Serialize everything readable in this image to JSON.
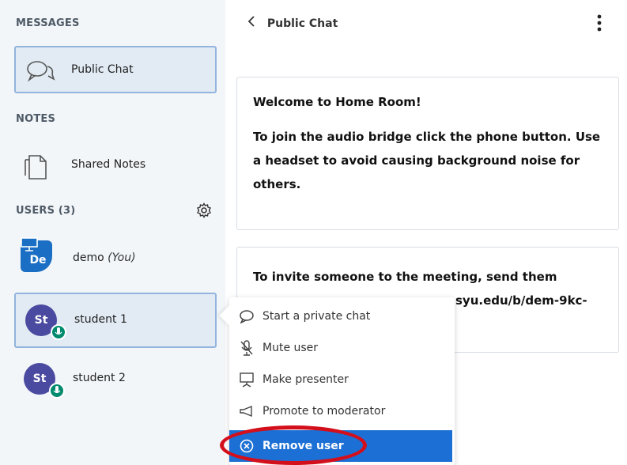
{
  "sidebar": {
    "messages_title": "MESSAGES",
    "public_chat_label": "Public Chat",
    "notes_title": "NOTES",
    "shared_notes_label": "Shared Notes",
    "users_title": "USERS (3)",
    "users": [
      {
        "initials": "De",
        "name": "demo",
        "suffix": "(You)",
        "role": "presenter"
      },
      {
        "initials": "St",
        "name": "student 1",
        "selected": true
      },
      {
        "initials": "St",
        "name": "student 2"
      }
    ]
  },
  "chat": {
    "header_title": "Public Chat",
    "welcome_messages": [
      "Welcome to Home Room!",
      "To join the audio bridge click the phone button. Use a headset to avoid causing background noise for others."
    ],
    "invite_message_partial": [
      "To invite someone to the meeting, send them",
      "syu.edu/b/dem-9kc-"
    ]
  },
  "context_menu": {
    "items": [
      {
        "label": "Start a private chat",
        "icon": "chat-bubble-icon"
      },
      {
        "label": "Mute user",
        "icon": "mic-mute-icon"
      },
      {
        "label": "Make presenter",
        "icon": "presentation-icon"
      },
      {
        "label": "Promote to moderator",
        "icon": "megaphone-icon"
      },
      {
        "label": "Remove user",
        "icon": "circle-x-icon",
        "highlighted": true
      }
    ]
  },
  "colors": {
    "accent_blue": "#1c6fd4",
    "avatar_purple": "#4a4aa0",
    "mic_green": "#008a6e",
    "highlight_red": "#d40f1c"
  }
}
